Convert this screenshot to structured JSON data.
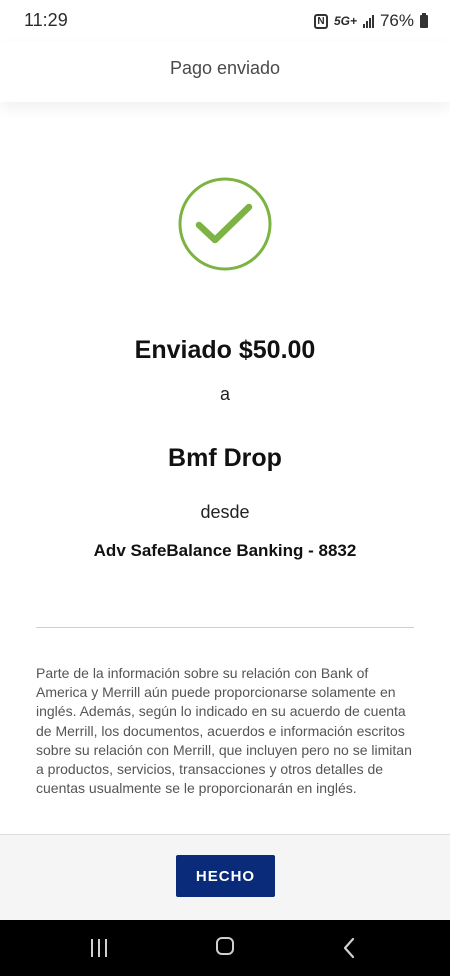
{
  "status_bar": {
    "time": "11:29",
    "network": "5G+",
    "battery": "76%",
    "icons": [
      "nfc-icon",
      "signal-icon",
      "battery-icon"
    ]
  },
  "header": {
    "title": "Pago enviado"
  },
  "confirmation": {
    "icon": "check-circle-icon",
    "accent_color": "#7cb342",
    "sent_text": "Enviado $50.00",
    "to_text": "a",
    "recipient": "Bmf Drop",
    "from_text": "desde",
    "account": "Adv SafeBalance Banking - 8832"
  },
  "disclaimer": "Parte de la información sobre su relación con Bank of America y Merrill aún puede proporcionarse solamente en inglés. Además, según lo indicado en su acuerdo de cuenta de Merrill, los documentos, acuerdos e información escritos sobre su relación con Merrill, que incluyen pero no se limitan a productos, servicios, transacciones y otros detalles de cuentas usualmente se le proporcionarán en inglés.",
  "footer": {
    "done_label": "HECHO",
    "button_color": "#0a2a7a"
  },
  "nav_bar": {
    "buttons": [
      "recents-icon",
      "home-icon",
      "back-icon"
    ]
  }
}
